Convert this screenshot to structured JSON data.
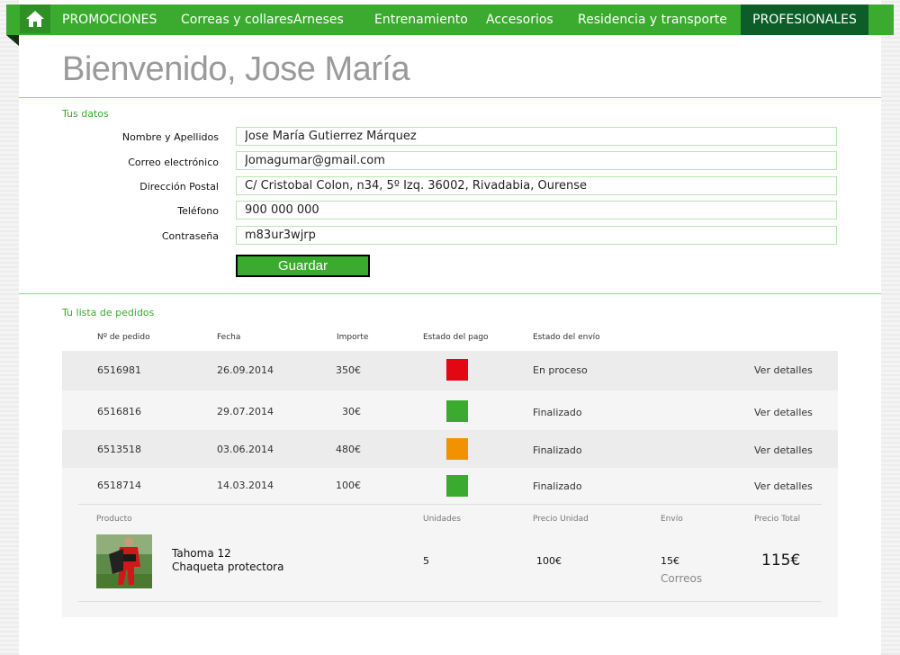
{
  "nav": {
    "items": [
      "PROMOCIONES",
      "Correas y collares",
      "Arneses",
      "Entrenamiento",
      "Accesorios",
      "Residencia y transporte"
    ],
    "pro": "PROFESIONALES"
  },
  "page": {
    "welcome": "Bienvenido, Jose María"
  },
  "profile": {
    "title": "Tus datos",
    "fields": [
      {
        "label": "Nombre y Apellidos",
        "value": "Jose María Gutierrez Márquez"
      },
      {
        "label": "Correo electrónico",
        "value": "Jomagumar@gmail.com"
      },
      {
        "label": "Dirección Postal",
        "value": "C/ Cristobal Colon, n34, 5º Izq. 36002, Rivadabia, Ourense"
      },
      {
        "label": "Teléfono",
        "value": "900 000 000"
      },
      {
        "label": "Contraseña",
        "value": "m83ur3wjrp"
      }
    ],
    "save_label": "Guardar"
  },
  "orders": {
    "title": "Tu lista de pedidos",
    "headers": [
      "Nº de pedido",
      "Fecha",
      "Importe",
      "Estado del pago",
      "Estado del envío"
    ],
    "rows": [
      {
        "id": "6516981",
        "date": "26.09.2014",
        "amount": "350€",
        "pay_color": "#e30613",
        "ship": "En proceso",
        "action": "Ver detalles"
      },
      {
        "id": "6516816",
        "date": "29.07.2014",
        "amount": "30€",
        "pay_color": "#3aab2e",
        "ship": "Finalizado",
        "action": "Ver detalles"
      },
      {
        "id": "6513518",
        "date": "03.06.2014",
        "amount": "480€",
        "pay_color": "#f39200",
        "ship": "Finalizado",
        "action": "Ver detalles"
      },
      {
        "id": "6518714",
        "date": "14.03.2014",
        "amount": "100€",
        "pay_color": "#3aab2e",
        "ship": "Finalizado",
        "action": "Ver detalles"
      }
    ],
    "detail": {
      "headers": [
        "Producto",
        "Unidades",
        "Precio Unidad",
        "Envío",
        "Precio Total"
      ],
      "product_name": "Tahoma 12",
      "product_desc": "Chaqueta protectora",
      "units": "5",
      "unit_price": "100€",
      "shipping": "15€",
      "carrier": "Correos",
      "total": "115€"
    }
  },
  "colors": {
    "brand": "#3aab2e",
    "pro": "#0c5d28",
    "pending": "#e30613",
    "paid": "#3aab2e",
    "partial": "#f39200"
  }
}
